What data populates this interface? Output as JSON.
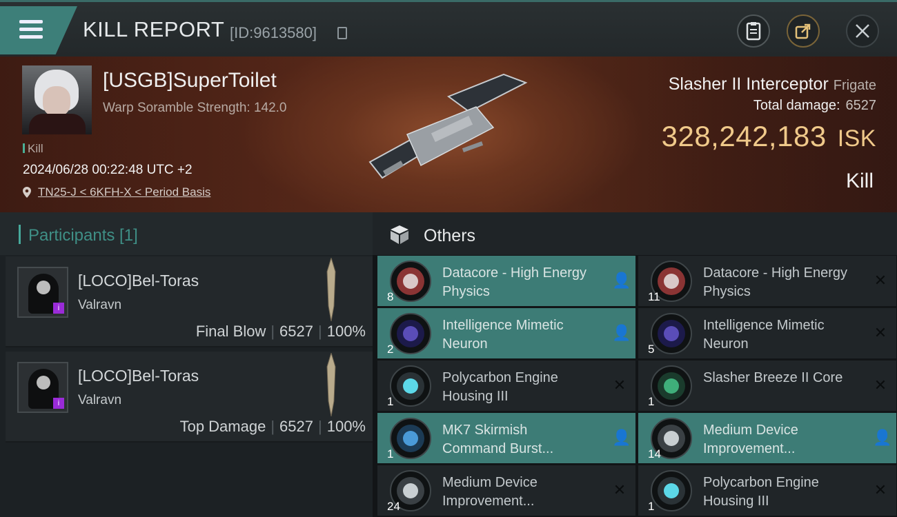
{
  "header": {
    "title": "KILL REPORT",
    "id_label": "[ID:9613580]"
  },
  "victim": {
    "name": "[USGB]SuperToilet",
    "warp_scramble": "Warp Soramble Strength: 142.0",
    "tag": "Kill",
    "datetime": "2024/06/28 00:22:48 UTC +2",
    "location": "TN25-J < 6KFH-X < Period Basis"
  },
  "ship": {
    "name": "Slasher II Interceptor",
    "class": "Frigate",
    "total_damage_label": "Total damage:",
    "total_damage": "6527",
    "isk_value": "328,242,183",
    "isk_unit": "ISK",
    "result": "Kill"
  },
  "participants": {
    "title": "Participants [1]",
    "rows": [
      {
        "name": "[LOCO]Bel-Toras",
        "ship": "Valravn",
        "role": "Final Blow",
        "damage": "6527",
        "percent": "100%"
      },
      {
        "name": "[LOCO]Bel-Toras",
        "ship": "Valravn",
        "role": "Top Damage",
        "damage": "6527",
        "percent": "100%"
      }
    ]
  },
  "others": {
    "title": "Others",
    "items": [
      {
        "name": "Datacore - High Energy Physics",
        "qty": "8",
        "icon": "datacore-icon",
        "highlight": true,
        "action": "person-icon"
      },
      {
        "name": "Datacore - High Energy Physics",
        "qty": "11",
        "icon": "datacore-icon",
        "highlight": false,
        "action": "close-icon"
      },
      {
        "name": "Intelligence Mimetic Neuron",
        "qty": "2",
        "icon": "neuron-icon",
        "highlight": true,
        "action": "person-icon"
      },
      {
        "name": "Intelligence Mimetic Neuron",
        "qty": "5",
        "icon": "neuron-icon",
        "highlight": false,
        "action": "close-icon"
      },
      {
        "name": "Polycarbon Engine Housing III",
        "qty": "1",
        "icon": "engine-icon",
        "highlight": false,
        "action": "close-icon"
      },
      {
        "name": "Slasher Breeze II Core",
        "qty": "1",
        "icon": "core-icon",
        "highlight": false,
        "action": "close-icon"
      },
      {
        "name": "MK7 Skirmish Command Burst...",
        "qty": "1",
        "icon": "burst-icon",
        "highlight": true,
        "action": "person-icon"
      },
      {
        "name": "Medium Device Improvement...",
        "qty": "14",
        "icon": "device-icon",
        "highlight": true,
        "action": "person-icon"
      },
      {
        "name": "Medium Device Improvement...",
        "qty": "24",
        "icon": "device-icon",
        "highlight": false,
        "action": "close-icon"
      },
      {
        "name": "Polycarbon Engine Housing III",
        "qty": "1",
        "icon": "engine-icon",
        "highlight": false,
        "action": "close-icon"
      }
    ]
  },
  "colors": {
    "accent": "#3d7f79",
    "isk": "#f0c98a",
    "highlight_row": "#3d7c76"
  }
}
